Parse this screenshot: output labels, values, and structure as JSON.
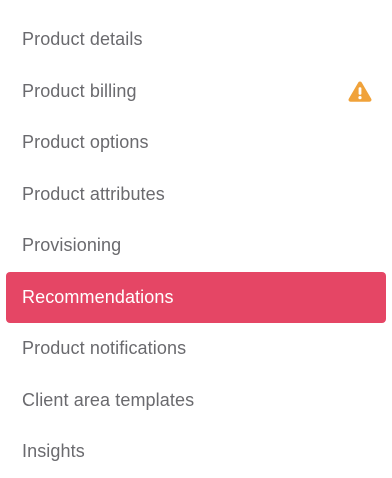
{
  "sidebar": {
    "items": [
      {
        "label": "Product details"
      },
      {
        "label": "Product billing",
        "icon": "warning-icon"
      },
      {
        "label": "Product options"
      },
      {
        "label": "Product attributes"
      },
      {
        "label": "Provisioning"
      },
      {
        "label": "Recommendations",
        "active": true
      },
      {
        "label": "Product notifications"
      },
      {
        "label": "Client area templates"
      },
      {
        "label": "Insights"
      }
    ],
    "colors": {
      "active_bg": "#e54665",
      "text": "#6a6a6e",
      "warning": "#f0a23a"
    }
  }
}
